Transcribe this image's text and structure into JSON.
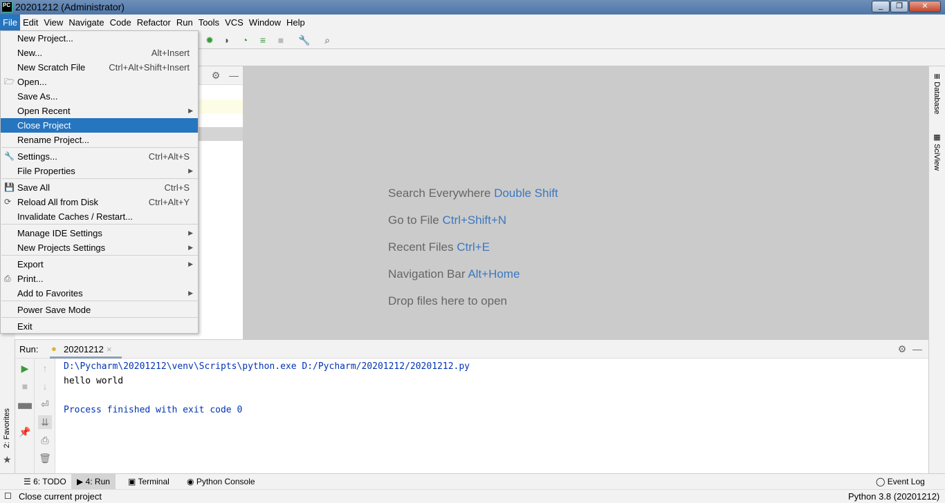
{
  "window": {
    "title": "20201212 (Administrator)",
    "logo": "PC",
    "controls": [
      "minimize",
      "maximize",
      "close"
    ]
  },
  "menubar": [
    "File",
    "Edit",
    "View",
    "Navigate",
    "Code",
    "Refactor",
    "Run",
    "Tools",
    "VCS",
    "Window",
    "Help"
  ],
  "file_menu": [
    {
      "label": "New Project..."
    },
    {
      "label": "New...",
      "shortcut": "Alt+Insert"
    },
    {
      "label": "New Scratch File",
      "shortcut": "Ctrl+Alt+Shift+Insert"
    },
    {
      "label": "Open...",
      "icon": "folder-icon"
    },
    {
      "label": "Save As..."
    },
    {
      "label": "Open Recent",
      "submenu": true
    },
    {
      "label": "Close Project",
      "selected": true
    },
    {
      "label": "Rename Project..."
    },
    {
      "label": "Settings...",
      "shortcut": "Ctrl+Alt+S",
      "icon": "wrench-icon"
    },
    {
      "label": "File Properties",
      "submenu": true
    },
    {
      "label": "Save All",
      "shortcut": "Ctrl+S",
      "icon": "save-icon"
    },
    {
      "label": "Reload All from Disk",
      "shortcut": "Ctrl+Alt+Y",
      "icon": "reload-icon"
    },
    {
      "label": "Invalidate Caches / Restart..."
    },
    {
      "label": "Manage IDE Settings",
      "submenu": true
    },
    {
      "label": "New Projects Settings",
      "submenu": true
    },
    {
      "label": "Export",
      "submenu": true
    },
    {
      "label": "Print...",
      "icon": "print-icon"
    },
    {
      "label": "Add to Favorites",
      "submenu": true
    },
    {
      "label": "Power Save Mode"
    },
    {
      "label": "Exit"
    }
  ],
  "editor_hints": [
    {
      "text": "Search Everywhere",
      "key": "Double Shift"
    },
    {
      "text": "Go to File",
      "key": "Ctrl+Shift+N"
    },
    {
      "text": "Recent Files",
      "key": "Ctrl+E"
    },
    {
      "text": "Navigation Bar",
      "key": "Alt+Home"
    },
    {
      "text": "Drop files here to open",
      "key": ""
    }
  ],
  "right_stripe": [
    "Database",
    "SciView"
  ],
  "left_stripe": "2: Favorites",
  "run": {
    "label": "Run:",
    "tab": "20201212",
    "console": [
      "D:\\Pycharm\\20201212\\venv\\Scripts\\python.exe D:/Pycharm/20201212/20201212.py",
      "hello world",
      "",
      "Process finished with exit code 0"
    ]
  },
  "bottom_tabs": [
    "6: TODO",
    "4: Run",
    "Terminal",
    "Python Console"
  ],
  "event_log": "Event Log",
  "status": {
    "message": "Close current project",
    "interpreter": "Python 3.8 (20201212)"
  },
  "colors": {
    "accent": "#2675bf",
    "console_text": "#0033b3",
    "hint_key": "#3a78c0"
  }
}
